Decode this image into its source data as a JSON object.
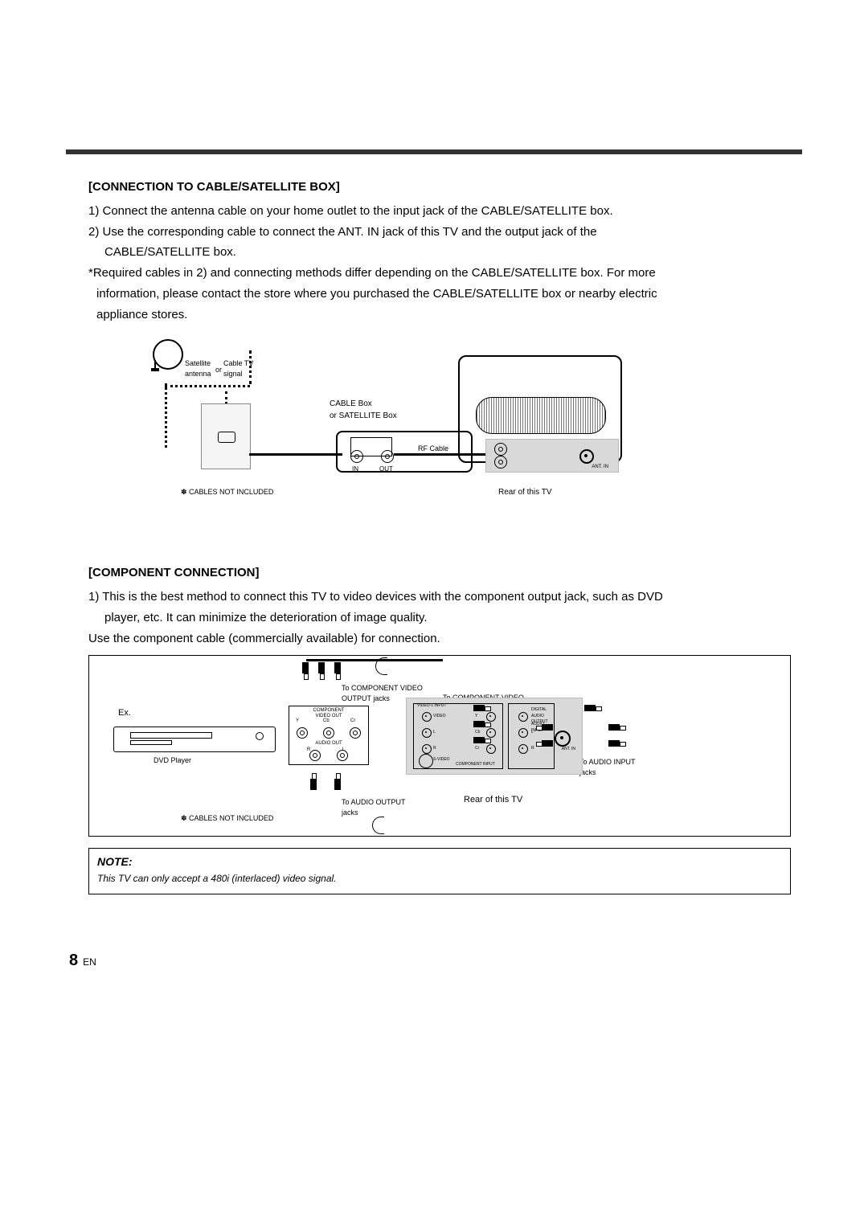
{
  "page": {
    "number": "8",
    "lang": "EN"
  },
  "section1": {
    "title": "[CONNECTION TO CABLE/SATELLITE BOX]",
    "p1": "1) Connect the antenna cable on your home outlet to the input jack of the CABLE/SATELLITE box.",
    "p2a": "2) Use the corresponding cable to connect the ANT. IN jack of this TV and the output jack of the",
    "p2b": "CABLE/SATELLITE box.",
    "p3a": "*Required cables in 2) and connecting methods differ depending on the CABLE/SATELLITE box. For more",
    "p3b": "information, please contact the store where you purchased the CABLE/SATELLITE box or nearby electric",
    "p3c": "appliance stores."
  },
  "fig1": {
    "satellite_label": "Satellite\nantenna",
    "or": "or",
    "cable_label": "Cable TV\nsignal",
    "cable_box": "CABLE Box\nor SATELLITE Box",
    "in": "IN",
    "out": "OUT",
    "rf": "RF Cable",
    "ant_in": "ANT. IN",
    "rear": "Rear of this TV",
    "cables_not_included": "✽ CABLES NOT INCLUDED"
  },
  "section2": {
    "title": "[COMPONENT CONNECTION]",
    "p1a": "1) This is the best method to connect this TV to video devices with the component output jack, such as DVD",
    "p1b": "player, etc. It can minimize the deterioration of image quality.",
    "p2": "Use the component cable (commercially available) for connection."
  },
  "fig2": {
    "ex": "Ex.",
    "dvd": "DVD Player",
    "comp_out_header": "COMPONENT\nVIDEO OUT",
    "y": "Y",
    "cb": "Cb",
    "cr": "Cr",
    "audio_out": "AUDIO OUT",
    "r": "R",
    "l": "L",
    "to_comp_out": "To COMPONENT VIDEO\nOUTPUT jacks",
    "to_audio_out": "To AUDIO OUTPUT\njacks",
    "to_comp_in": "To COMPONENT VIDEO\nINPUT jacks",
    "to_audio_in": "To AUDIO INPUT\njacks",
    "rear": "Rear of this TV",
    "cables_not_included": "✽ CABLES NOT INCLUDED",
    "panel": {
      "video1_input": "VIDEO-1 INPUT",
      "video": "VIDEO",
      "s_video": "S-VIDEO",
      "y": "Y",
      "cb": "Cb",
      "cr": "Cr",
      "component_input": "COMPONENT INPUT",
      "digital_audio_output": "DIGITAL\nAUDIO\nOUTPUT",
      "audio_input": "AUDIO\nINPUT",
      "l": "L",
      "r": "R",
      "ant_in": "ANT. IN"
    }
  },
  "note": {
    "title": "NOTE:",
    "body": "This TV can only accept a 480i (interlaced) video signal."
  }
}
